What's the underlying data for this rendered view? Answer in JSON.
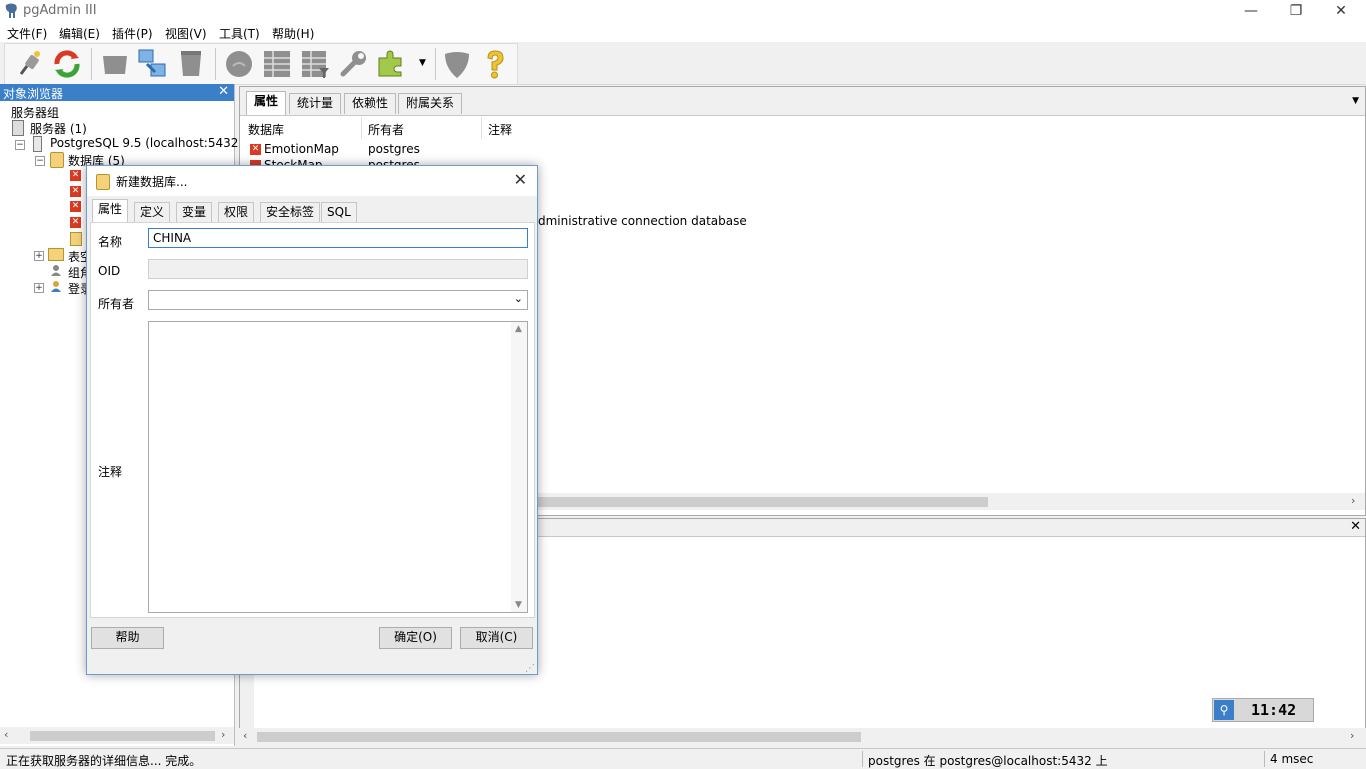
{
  "app": {
    "title": "pgAdmin III"
  },
  "window_controls": {
    "minimize": "—",
    "maximize": "❐",
    "close": "✕"
  },
  "menu": [
    "文件(F)",
    "编辑(E)",
    "插件(P)",
    "视图(V)",
    "工具(T)",
    "帮助(H)"
  ],
  "toolbar": {
    "icons": [
      "connect-icon",
      "refresh-icon",
      "drop-icon",
      "sql-query-icon",
      "stop-icon",
      "vacuum-icon",
      "view-data-icon",
      "filtered-data-icon",
      "maintenance-icon",
      "plugins-icon",
      "hint-icon",
      "help-icon"
    ]
  },
  "object_browser": {
    "title": "对象浏览器",
    "close": "✕",
    "tree": {
      "server_groups": "服务器组",
      "servers": "服务器 (1)",
      "server": "PostgreSQL 9.5 (localhost:5432)",
      "databases": "数据库 (5)",
      "tablespaces": "表空",
      "group_roles": "组角",
      "login_roles": "登录"
    }
  },
  "properties_pane": {
    "tabs": [
      "属性",
      "统计量",
      "依赖性",
      "附属关系"
    ],
    "columns": [
      "数据库",
      "所有者",
      "注释"
    ],
    "rows": [
      {
        "name": "EmotionMap",
        "owner": "postgres",
        "comment": ""
      },
      {
        "name": "StockMap",
        "owner": "postgres",
        "comment": ""
      }
    ],
    "partial_comment": "dministrative connection database"
  },
  "sql_pane": {
    "close": "✕"
  },
  "clock": {
    "pin": "⚲",
    "time": "11:42"
  },
  "dialog": {
    "title": "新建数据库...",
    "close": "✕",
    "tabs": [
      "属性",
      "定义",
      "变量",
      "权限",
      "安全标签",
      "SQL"
    ],
    "fields": {
      "name_label": "名称",
      "name_value": "CHINA",
      "oid_label": "OID",
      "oid_value": "",
      "owner_label": "所有者",
      "owner_value": "",
      "comment_label": "注释",
      "comment_value": ""
    },
    "buttons": {
      "help": "帮助",
      "ok": "确定(O)",
      "cancel": "取消(C)"
    }
  },
  "status_bar": {
    "message": "正在获取服务器的详细信息... 完成。",
    "connection": "postgres 在  postgres@localhost:5432 上",
    "timing": "4 msec"
  }
}
